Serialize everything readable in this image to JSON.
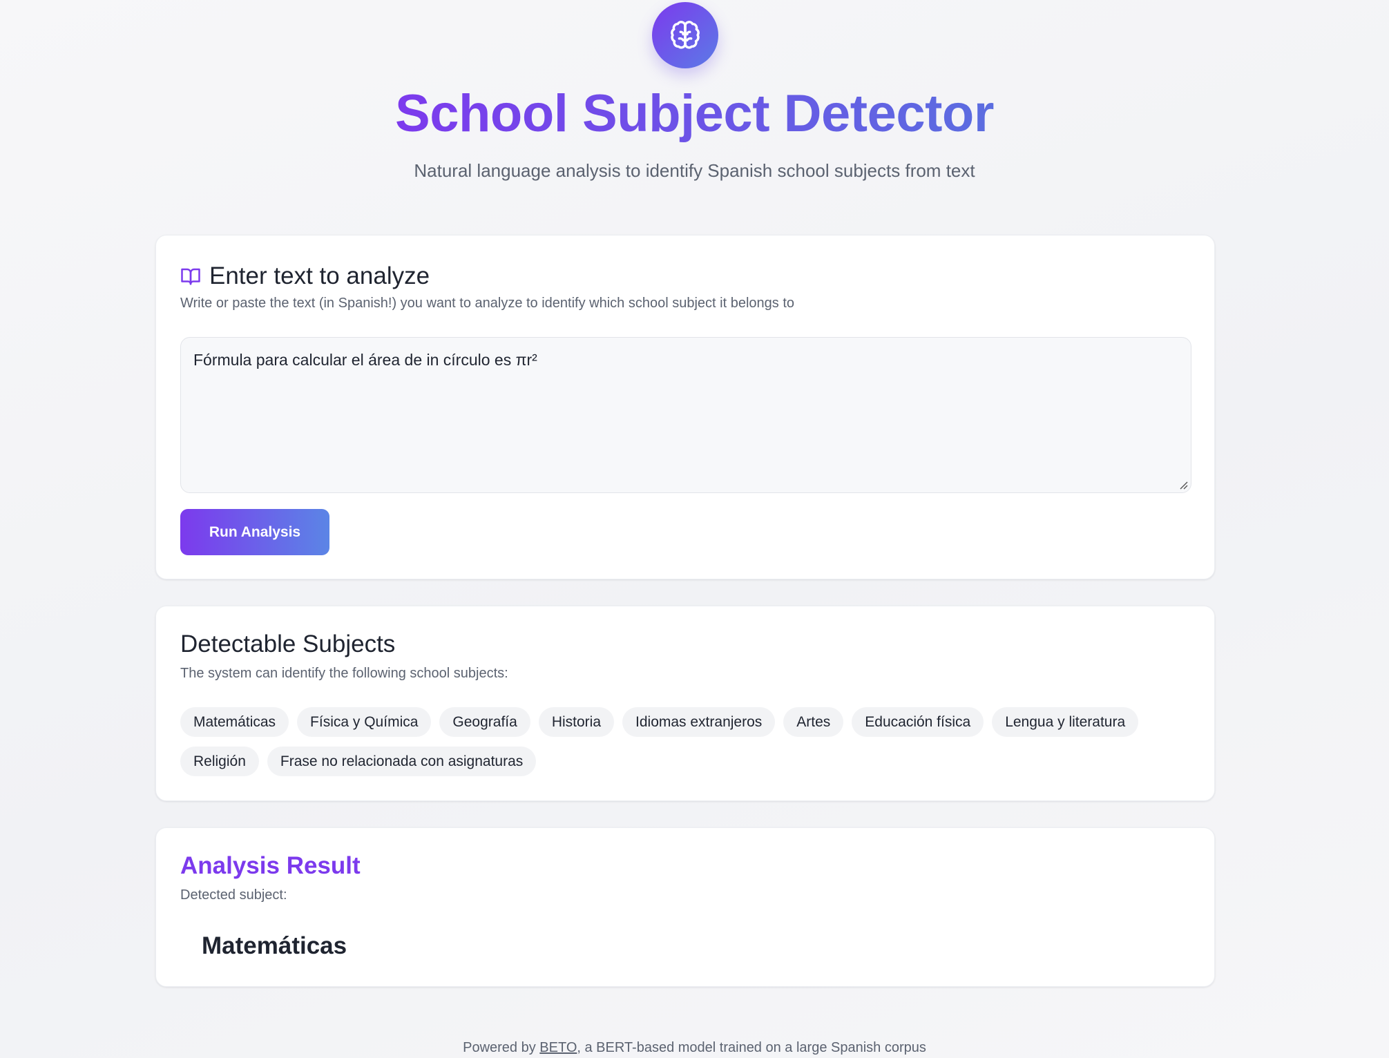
{
  "header": {
    "logo_icon": "brain-icon",
    "title": "School Subject Detector",
    "subtitle": "Natural language analysis to identify Spanish school subjects from text"
  },
  "input_card": {
    "icon": "book-open-icon",
    "title": "Enter text to analyze",
    "description": "Write or paste the text (in Spanish!) you want to analyze to identify which school subject it belongs to",
    "textarea_value": "Fórmula para calcular el área de in círculo es πr²",
    "run_button_label": "Run Analysis"
  },
  "subjects_card": {
    "title": "Detectable Subjects",
    "description": "The system can identify the following school subjects:",
    "subjects": [
      "Matemáticas",
      "Física y Química",
      "Geografía",
      "Historia",
      "Idiomas extranjeros",
      "Artes",
      "Educación física",
      "Lengua y literatura",
      "Religión",
      "Frase no relacionada con asignaturas"
    ]
  },
  "result_card": {
    "title": "Analysis Result",
    "label": "Detected subject:",
    "value": "Matemáticas"
  },
  "footer": {
    "prefix": "Powered by ",
    "link_text": "BETO",
    "suffix": ", a BERT-based model trained on a large Spanish corpus"
  },
  "colors": {
    "accent_purple": "#7c3aed",
    "accent_blue": "#5b85e6",
    "background": "#f6f6f8",
    "chip_background": "#f2f3f5"
  }
}
